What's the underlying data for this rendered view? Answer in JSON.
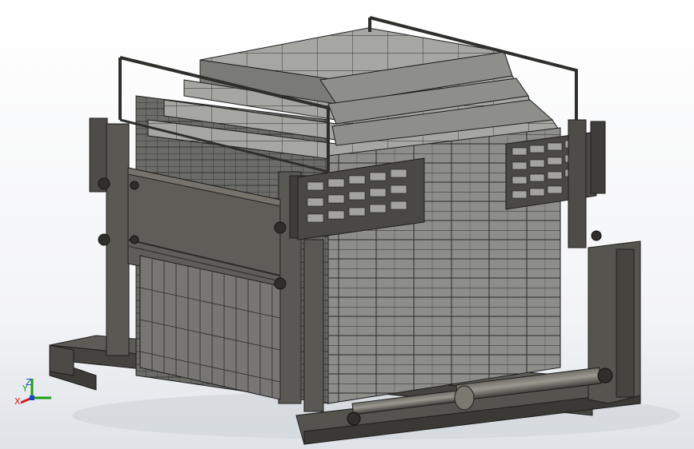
{
  "viewport": {
    "background_top": "#ffffff",
    "background_bottom": "#dfe3e8"
  },
  "model": {
    "description_colors": {
      "steel": "#5c5a55",
      "steel_dark": "#3d3b37",
      "steel_light": "#76736c",
      "brick_face": "#8a8a87",
      "brick_top": "#a9a9a6",
      "brick_side": "#6d6d6a",
      "edge": "#1e1e1e"
    }
  },
  "triad": {
    "x_label": "X",
    "y_label": "Y",
    "z_label": "Z",
    "x_color": "#d02020",
    "y_color": "#1aa01a",
    "z_color": "#2040d0"
  }
}
